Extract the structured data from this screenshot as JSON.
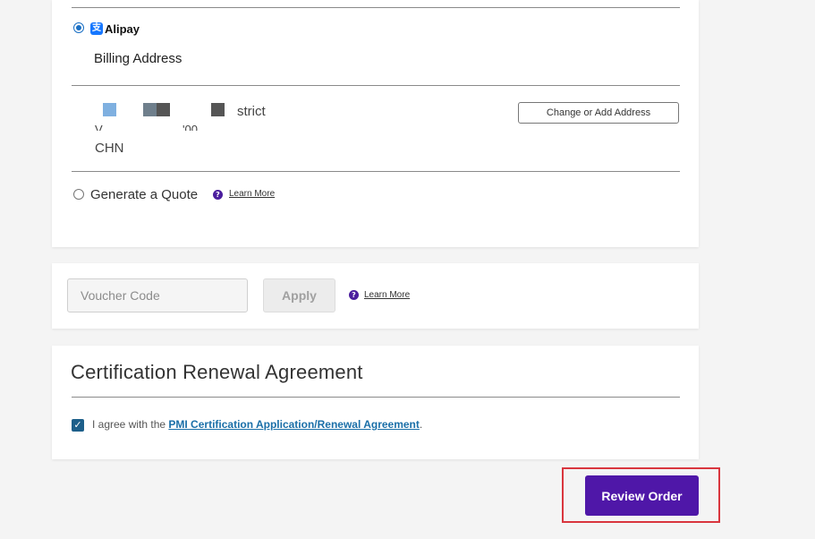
{
  "payment": {
    "method_label": "Alipay",
    "billing_title": "Billing Address",
    "address_line1_suffix": "strict",
    "address_line2_fragment_left": "V",
    "address_line2_fragment_right": "'00",
    "address_country": "CHN",
    "change_address_label": "Change or Add Address",
    "quote_label": "Generate a Quote",
    "quote_learn_more": "Learn More"
  },
  "voucher": {
    "placeholder": "Voucher Code",
    "apply_label": "Apply",
    "learn_more": "Learn More"
  },
  "agreement": {
    "title": "Certification Renewal Agreement",
    "agree_prefix": "I agree with the ",
    "agree_link": "PMI Certification Application/Renewal Agreement",
    "agree_suffix": ".",
    "checked": true
  },
  "actions": {
    "review_order_label": "Review Order"
  },
  "colors": {
    "accent": "#4f17a8",
    "highlight": "#d9363e",
    "link": "#1a6fa8"
  }
}
